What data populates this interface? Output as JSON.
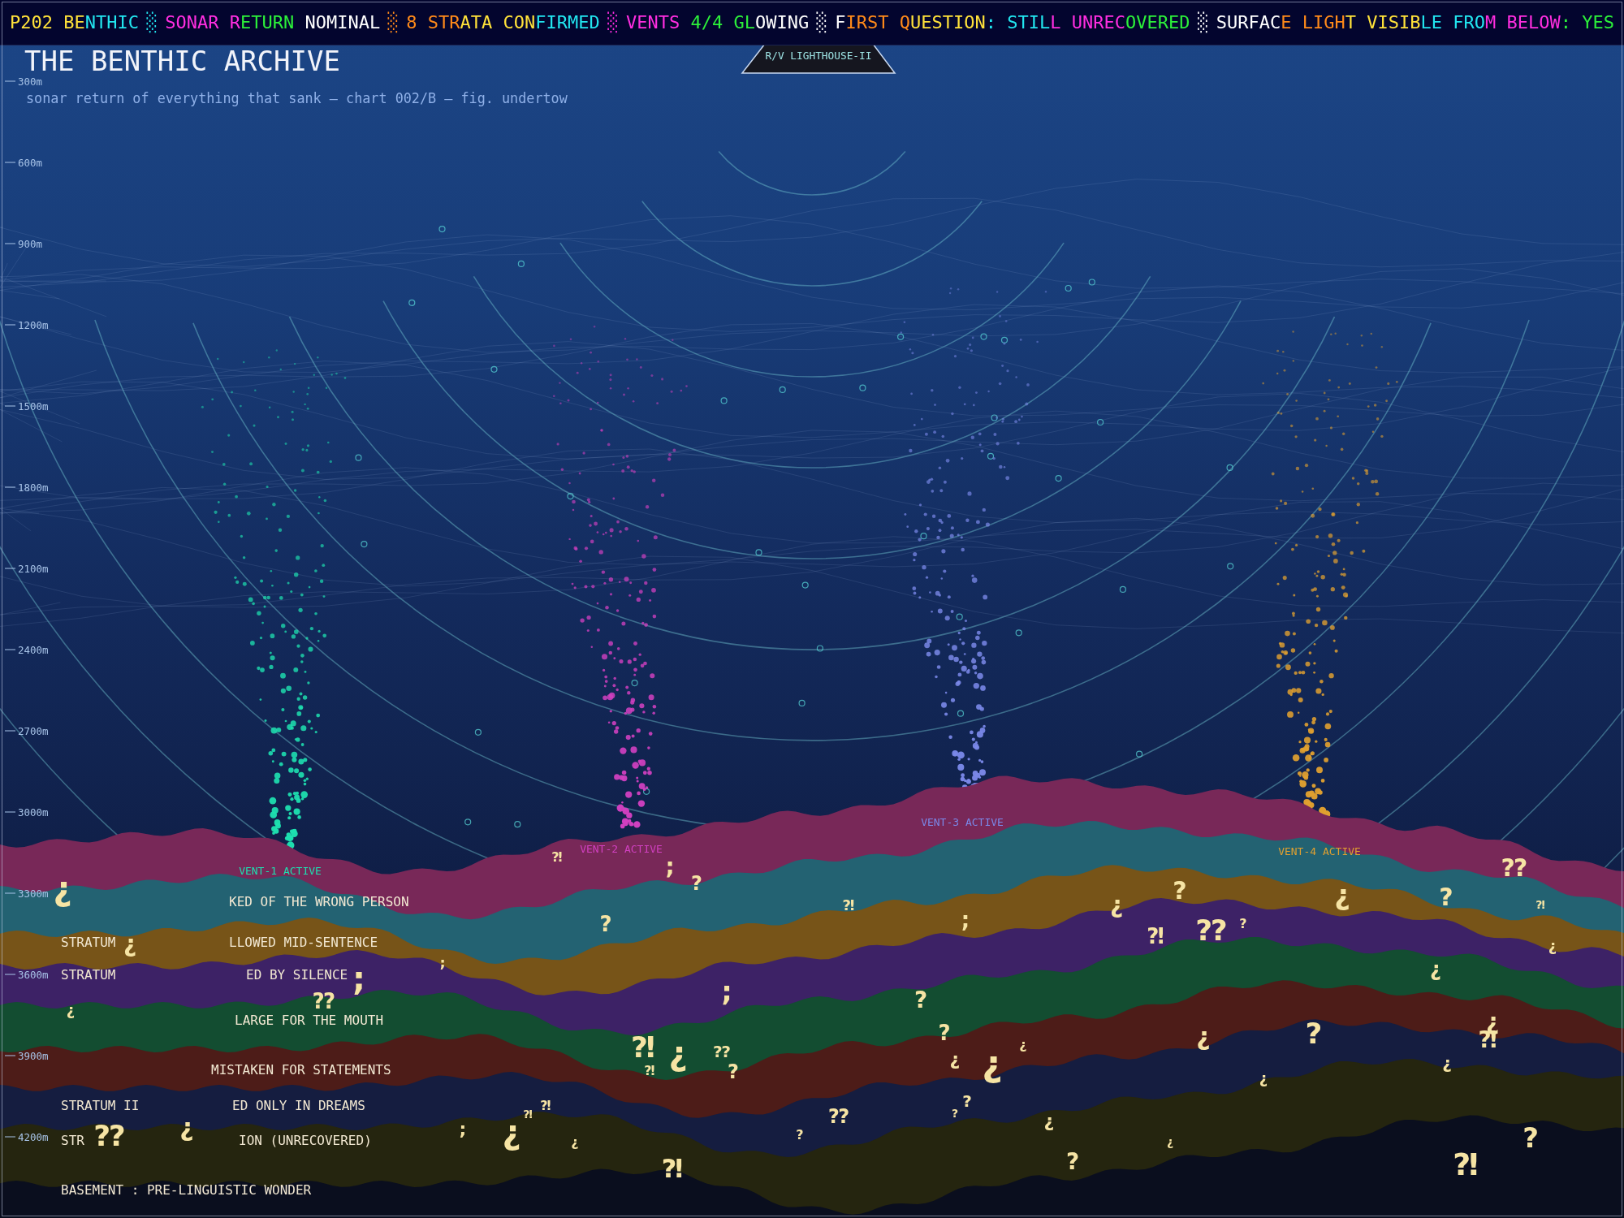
{
  "ticker": {
    "separator": "░",
    "messages": [
      "P202 BENTHIC",
      "SONAR RETURN NOMINAL",
      "8 STRATA CONFIRMED",
      "VENTS 4/4 GLOWING",
      "FIRST QUESTION: STILL UNRECOVERED",
      "SURFACE LIGHT VISIBLE FROM BELOW: YES"
    ]
  },
  "title": "THE BENTHIC ARCHIVE",
  "subtitle": "sonar return of everything that sank — chart 002/B — fig. undertow",
  "ship": {
    "name": "R/V LIGHTHOUSE-II"
  },
  "depth_axis": [
    "300m",
    "600m",
    "900m",
    "1200m",
    "1500m",
    "1800m",
    "2100m",
    "2400m",
    "2700m",
    "3000m",
    "3300m",
    "3600m",
    "3900m",
    "4200m"
  ],
  "vents": [
    {
      "label": "VENT-1 ACTIVE",
      "color": "#1ee0b0"
    },
    {
      "label": "VENT-2 ACTIVE",
      "color": "#d040c0"
    },
    {
      "label": "VENT-3 ACTIVE",
      "color": "#7a88e8"
    },
    {
      "label": "VENT-4 ACTIVE",
      "color": "#e0a030"
    }
  ],
  "strata_labels": [
    {
      "right": "KED OF THE WRONG PERSON"
    },
    {
      "left": "STRATUM",
      "right": "LLOWED MID-SENTENCE"
    },
    {
      "left": "STRATUM",
      "right": "ED BY SILENCE"
    },
    {
      "right": "LARGE FOR THE MOUTH"
    },
    {
      "right": "MISTAKEN FOR STATEMENTS"
    },
    {
      "left": "STRATUM II",
      "right": "ED ONLY IN DREAMS"
    },
    {
      "left": "STR",
      "right": "ION (UNRECOVERED)"
    },
    {
      "left": "BASEMENT : PRE-LINGUISTIC WONDER"
    }
  ],
  "glyphs": [
    "¿",
    "¿",
    "¿",
    "⁇",
    "¿",
    "⁇",
    ";",
    ";",
    ";",
    "¿",
    "⁈",
    "⁈",
    "⁈",
    "¿",
    "?",
    "⁈",
    "⁈",
    ";",
    "¿",
    "⁈",
    "?",
    ";",
    "⁇",
    "?",
    "?",
    "⁈",
    "⁇",
    "?",
    "?",
    "¿",
    "?",
    ";",
    "?",
    "¿",
    "¿",
    "¿",
    "?",
    "¿",
    "⁈",
    "?",
    "¿",
    "⁇",
    "¿",
    "?",
    "¿",
    "?",
    "¿",
    "?",
    "¿",
    "¿",
    "⁈",
    "¿",
    "⁈",
    "⁇",
    "⁈",
    "?",
    "¿"
  ]
}
